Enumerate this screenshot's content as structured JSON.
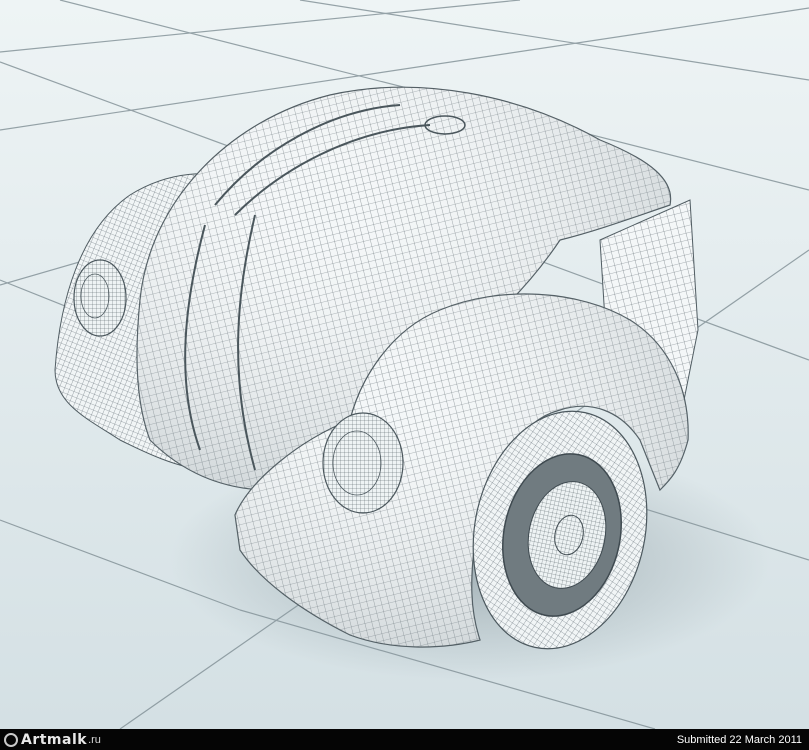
{
  "render": {
    "subject": "wireframe-car-front",
    "colors": {
      "floor_light": "#eef4f5",
      "floor_dark": "#c9d7dc",
      "grid_line": "#8c9ba1",
      "mesh_fill": "#f3f6f7",
      "mesh_line": "#5e6a70",
      "shadow": "#9aa9ae",
      "wheel_rim": "#6f7a7e",
      "footer_bg": "#050505"
    }
  },
  "footer": {
    "logo_name": "Artmalk",
    "logo_tld": ".ru",
    "submitted": "Submitted 22 March 2011"
  }
}
